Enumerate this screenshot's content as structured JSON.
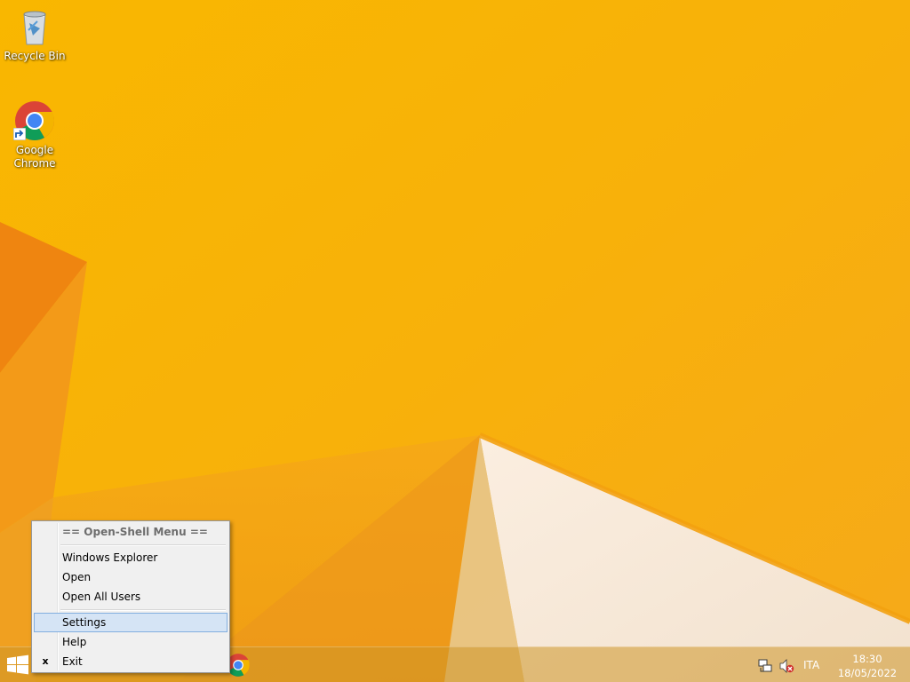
{
  "desktop": {
    "background_color": "#f7b500",
    "icons": [
      {
        "label": "Recycle Bin",
        "icon": "recycle-bin-icon"
      },
      {
        "label": "Google\nChrome",
        "icon": "chrome-icon"
      }
    ]
  },
  "context_menu": {
    "header": "== Open-Shell Menu ==",
    "items": [
      {
        "label": "Windows Explorer"
      },
      {
        "label": "Open"
      },
      {
        "label": "Open All Users"
      },
      {
        "label": "Settings",
        "state": "highlighted"
      },
      {
        "label": "Help"
      },
      {
        "label": "Exit",
        "check": "x"
      }
    ],
    "highlight_color": "#d5e4f5"
  },
  "taskbar": {
    "start_icon": "windows-logo-icon",
    "apps": [
      {
        "name": "Google Chrome",
        "icon": "chrome-icon"
      }
    ],
    "tray": {
      "network_icon": "network-icon",
      "volume_icon": "volume-muted-icon",
      "language": "ITA",
      "time": "18:30",
      "date": "18/05/2022"
    }
  }
}
